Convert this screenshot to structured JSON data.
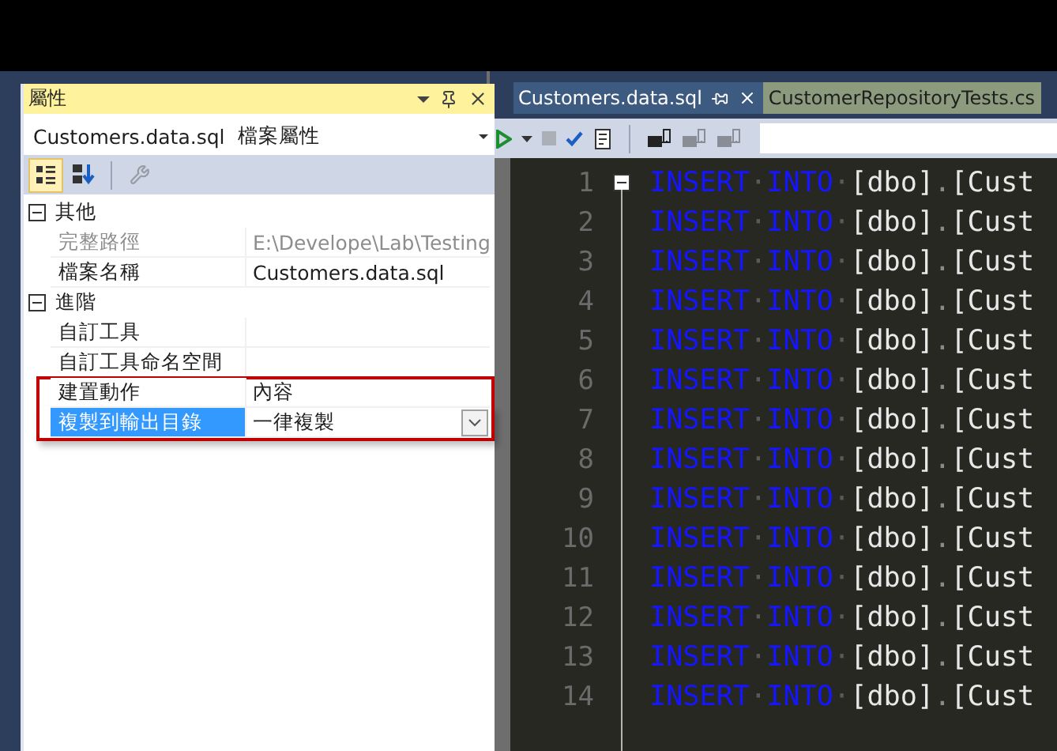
{
  "properties_pane": {
    "title": "屬性",
    "object": {
      "name": "Customers.data.sql",
      "type": "檔案屬性"
    },
    "toolbar": [
      {
        "kind": "categorized",
        "selected": true,
        "disabled": false
      },
      {
        "kind": "alphabetical",
        "selected": false,
        "disabled": false
      },
      {
        "kind": "property_pages",
        "selected": false,
        "disabled": true
      }
    ],
    "categories": [
      {
        "name": "其他",
        "expanded": true,
        "properties": [
          {
            "name": "完整路徑",
            "value": "E:\\Develope\\Lab\\Testing",
            "readonly": true,
            "selected": false,
            "highlighted": false
          },
          {
            "name": "檔案名稱",
            "value": "Customers.data.sql",
            "readonly": false,
            "selected": false,
            "highlighted": false
          }
        ]
      },
      {
        "name": "進階",
        "expanded": true,
        "properties": [
          {
            "name": "自訂工具",
            "readonly": false,
            "selected": false,
            "highlighted": false
          },
          {
            "name": "自訂工具命名空間",
            "readonly": false,
            "selected": false,
            "highlighted": false
          },
          {
            "name": "建置動作",
            "value": "內容",
            "readonly": false,
            "selected": false,
            "highlighted": true
          },
          {
            "name": "複製到輸出目錄",
            "value": "一律複製",
            "readonly": false,
            "selected": true,
            "highlighted": true
          }
        ]
      }
    ]
  },
  "editor": {
    "tabs": [
      {
        "label": "Customers.data.sql",
        "selected": true
      },
      {
        "label": "CustomerRepositoryTests.cs",
        "selected": false
      }
    ],
    "toolbar": [
      {
        "kind": "execute",
        "disabled": false
      },
      {
        "kind": "dropdown",
        "disabled": false
      },
      {
        "kind": "stop",
        "disabled": true
      },
      {
        "kind": "check",
        "disabled": false
      },
      {
        "kind": "plan",
        "disabled": false
      },
      {
        "kind": "separator"
      },
      {
        "kind": "connect",
        "disabled": false
      },
      {
        "kind": "disconnect",
        "disabled": true
      },
      {
        "kind": "change_connection",
        "disabled": true
      }
    ],
    "lines": [
      {
        "number": "1",
        "tokens": [
          {
            "kind": "keyword",
            "text": "INSERT"
          },
          {
            "kind": "space",
            "text": "·"
          },
          {
            "kind": "keyword",
            "text": "INTO"
          },
          {
            "kind": "space",
            "text": "·"
          },
          {
            "kind": "name",
            "text": "[dbo]"
          },
          {
            "kind": "punct",
            "text": "."
          },
          {
            "kind": "name",
            "text": "[Cust"
          }
        ]
      },
      {
        "number": "2",
        "tokens": [
          {
            "kind": "keyword",
            "text": "INSERT"
          },
          {
            "kind": "space",
            "text": "·"
          },
          {
            "kind": "keyword",
            "text": "INTO"
          },
          {
            "kind": "space",
            "text": "·"
          },
          {
            "kind": "name",
            "text": "[dbo]"
          },
          {
            "kind": "punct",
            "text": "."
          },
          {
            "kind": "name",
            "text": "[Cust"
          }
        ]
      },
      {
        "number": "3",
        "tokens": [
          {
            "kind": "keyword",
            "text": "INSERT"
          },
          {
            "kind": "space",
            "text": "·"
          },
          {
            "kind": "keyword",
            "text": "INTO"
          },
          {
            "kind": "space",
            "text": "·"
          },
          {
            "kind": "name",
            "text": "[dbo]"
          },
          {
            "kind": "punct",
            "text": "."
          },
          {
            "kind": "name",
            "text": "[Cust"
          }
        ]
      },
      {
        "number": "4",
        "tokens": [
          {
            "kind": "keyword",
            "text": "INSERT"
          },
          {
            "kind": "space",
            "text": "·"
          },
          {
            "kind": "keyword",
            "text": "INTO"
          },
          {
            "kind": "space",
            "text": "·"
          },
          {
            "kind": "name",
            "text": "[dbo]"
          },
          {
            "kind": "punct",
            "text": "."
          },
          {
            "kind": "name",
            "text": "[Cust"
          }
        ]
      },
      {
        "number": "5",
        "tokens": [
          {
            "kind": "keyword",
            "text": "INSERT"
          },
          {
            "kind": "space",
            "text": "·"
          },
          {
            "kind": "keyword",
            "text": "INTO"
          },
          {
            "kind": "space",
            "text": "·"
          },
          {
            "kind": "name",
            "text": "[dbo]"
          },
          {
            "kind": "punct",
            "text": "."
          },
          {
            "kind": "name",
            "text": "[Cust"
          }
        ]
      },
      {
        "number": "6",
        "tokens": [
          {
            "kind": "keyword",
            "text": "INSERT"
          },
          {
            "kind": "space",
            "text": "·"
          },
          {
            "kind": "keyword",
            "text": "INTO"
          },
          {
            "kind": "space",
            "text": "·"
          },
          {
            "kind": "name",
            "text": "[dbo]"
          },
          {
            "kind": "punct",
            "text": "."
          },
          {
            "kind": "name",
            "text": "[Cust"
          }
        ]
      },
      {
        "number": "7",
        "tokens": [
          {
            "kind": "keyword",
            "text": "INSERT"
          },
          {
            "kind": "space",
            "text": "·"
          },
          {
            "kind": "keyword",
            "text": "INTO"
          },
          {
            "kind": "space",
            "text": "·"
          },
          {
            "kind": "name",
            "text": "[dbo]"
          },
          {
            "kind": "punct",
            "text": "."
          },
          {
            "kind": "name",
            "text": "[Cust"
          }
        ]
      },
      {
        "number": "8",
        "tokens": [
          {
            "kind": "keyword",
            "text": "INSERT"
          },
          {
            "kind": "space",
            "text": "·"
          },
          {
            "kind": "keyword",
            "text": "INTO"
          },
          {
            "kind": "space",
            "text": "·"
          },
          {
            "kind": "name",
            "text": "[dbo]"
          },
          {
            "kind": "punct",
            "text": "."
          },
          {
            "kind": "name",
            "text": "[Cust"
          }
        ]
      },
      {
        "number": "9",
        "tokens": [
          {
            "kind": "keyword",
            "text": "INSERT"
          },
          {
            "kind": "space",
            "text": "·"
          },
          {
            "kind": "keyword",
            "text": "INTO"
          },
          {
            "kind": "space",
            "text": "·"
          },
          {
            "kind": "name",
            "text": "[dbo]"
          },
          {
            "kind": "punct",
            "text": "."
          },
          {
            "kind": "name",
            "text": "[Cust"
          }
        ]
      },
      {
        "number": "10",
        "tokens": [
          {
            "kind": "keyword",
            "text": "INSERT"
          },
          {
            "kind": "space",
            "text": "·"
          },
          {
            "kind": "keyword",
            "text": "INTO"
          },
          {
            "kind": "space",
            "text": "·"
          },
          {
            "kind": "name",
            "text": "[dbo]"
          },
          {
            "kind": "punct",
            "text": "."
          },
          {
            "kind": "name",
            "text": "[Cust"
          }
        ]
      },
      {
        "number": "11",
        "tokens": [
          {
            "kind": "keyword",
            "text": "INSERT"
          },
          {
            "kind": "space",
            "text": "·"
          },
          {
            "kind": "keyword",
            "text": "INTO"
          },
          {
            "kind": "space",
            "text": "·"
          },
          {
            "kind": "name",
            "text": "[dbo]"
          },
          {
            "kind": "punct",
            "text": "."
          },
          {
            "kind": "name",
            "text": "[Cust"
          }
        ]
      },
      {
        "number": "12",
        "tokens": [
          {
            "kind": "keyword",
            "text": "INSERT"
          },
          {
            "kind": "space",
            "text": "·"
          },
          {
            "kind": "keyword",
            "text": "INTO"
          },
          {
            "kind": "space",
            "text": "·"
          },
          {
            "kind": "name",
            "text": "[dbo]"
          },
          {
            "kind": "punct",
            "text": "."
          },
          {
            "kind": "name",
            "text": "[Cust"
          }
        ]
      },
      {
        "number": "13",
        "tokens": [
          {
            "kind": "keyword",
            "text": "INSERT"
          },
          {
            "kind": "space",
            "text": "·"
          },
          {
            "kind": "keyword",
            "text": "INTO"
          },
          {
            "kind": "space",
            "text": "·"
          },
          {
            "kind": "name",
            "text": "[dbo]"
          },
          {
            "kind": "punct",
            "text": "."
          },
          {
            "kind": "name",
            "text": "[Cust"
          }
        ]
      },
      {
        "number": "14",
        "tokens": [
          {
            "kind": "keyword",
            "text": "INSERT"
          },
          {
            "kind": "space",
            "text": "·"
          },
          {
            "kind": "keyword",
            "text": "INTO"
          },
          {
            "kind": "space",
            "text": "·"
          },
          {
            "kind": "name",
            "text": "[dbo]"
          },
          {
            "kind": "punct",
            "text": "."
          },
          {
            "kind": "name",
            "text": "[Cust"
          }
        ]
      }
    ]
  }
}
